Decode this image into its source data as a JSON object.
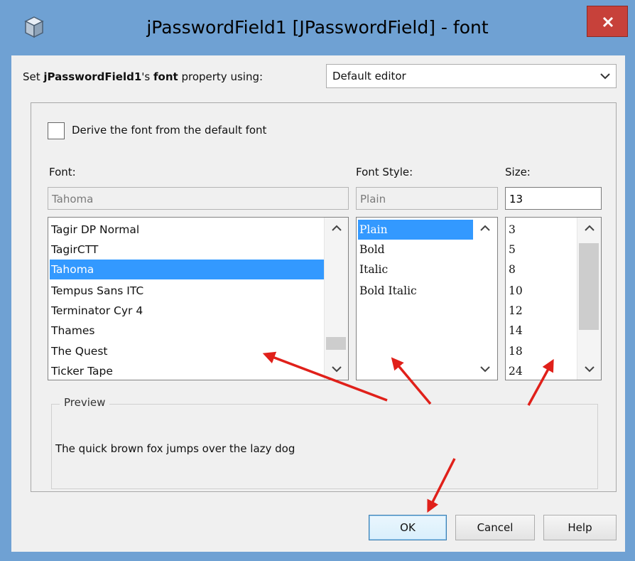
{
  "window": {
    "title": "jPasswordField1 [JPasswordField] - font",
    "icons": {
      "app": "cube-icon",
      "close": "close-x-icon"
    },
    "colors": {
      "frame": "#6fa1d3",
      "close": "#c7413a",
      "selection": "#3399ff",
      "annotation": "#e0201a"
    }
  },
  "property": {
    "prefix": "Set ",
    "component": "jPasswordField1",
    "possessive": "'s ",
    "prop": "font",
    "suffix": " property using:",
    "editor_value": "Default editor"
  },
  "derive": {
    "label": "Derive the font from the default font",
    "checked": false
  },
  "font": {
    "label": "Font:",
    "value": "Tahoma",
    "items": [
      "Tagir DP Normal",
      "TagirCTT",
      "Tahoma",
      "Tempus Sans ITC",
      "Terminator Cyr 4",
      "Thames",
      "The Quest",
      "Ticker Tape"
    ],
    "selected": "Tahoma"
  },
  "style": {
    "label": "Font Style:",
    "value": "Plain",
    "items": [
      "Plain",
      "Bold",
      "Italic",
      "Bold Italic"
    ],
    "selected": "Plain"
  },
  "size": {
    "label": "Size:",
    "value": "13",
    "items": [
      "3",
      "5",
      "8",
      "10",
      "12",
      "14",
      "18",
      "24"
    ]
  },
  "preview": {
    "title": "Preview",
    "text": "The quick brown fox jumps over the lazy dog"
  },
  "buttons": {
    "ok": "OK",
    "cancel": "Cancel",
    "help": "Help"
  }
}
